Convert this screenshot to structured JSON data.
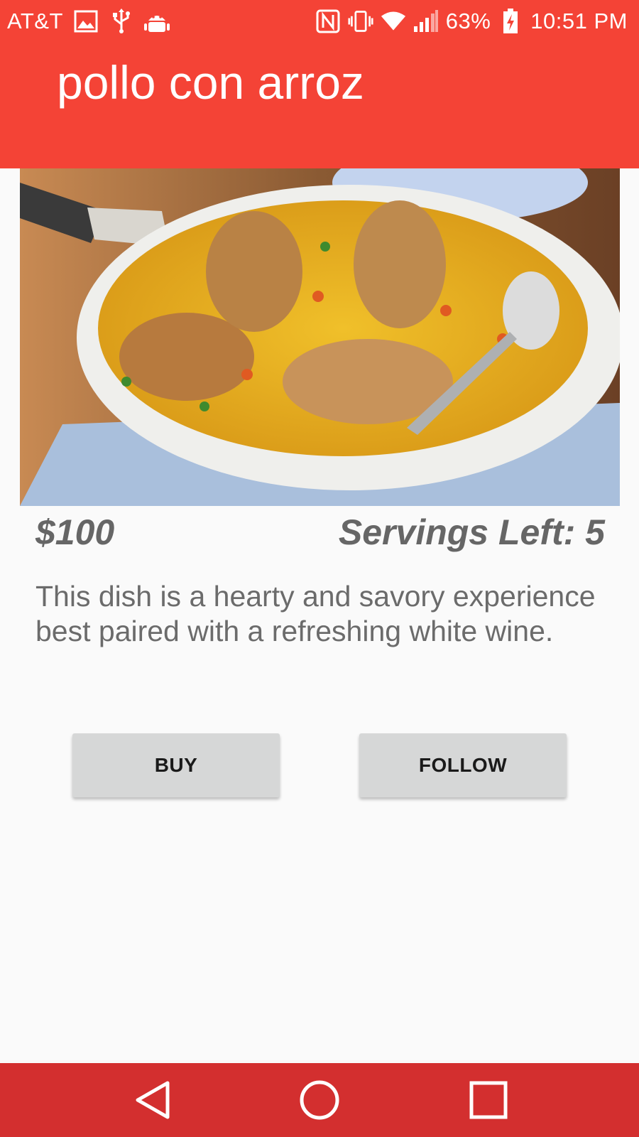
{
  "status_bar": {
    "carrier": "AT&T",
    "battery": "63%",
    "time": "10:51 PM",
    "icons_left": [
      "image-icon",
      "usb-icon",
      "android-debug-icon"
    ],
    "icons_right": [
      "nfc-icon",
      "vibrate-icon",
      "wifi-icon",
      "signal-icon",
      "battery-charging-icon"
    ]
  },
  "app_bar": {
    "title": "pollo con arroz",
    "color": "#f44336"
  },
  "dish": {
    "image": "chicken-and-rice-photo",
    "price": "$100",
    "servings": "Servings Left: 5",
    "description": "This dish is a hearty and savory experience best paired with a refreshing white wine."
  },
  "actions": {
    "buy_label": "BUY",
    "follow_label": "FOLLOW"
  },
  "nav_bar": {
    "color": "#d32f2f",
    "icons": [
      "back-icon",
      "home-icon",
      "recents-icon"
    ]
  }
}
